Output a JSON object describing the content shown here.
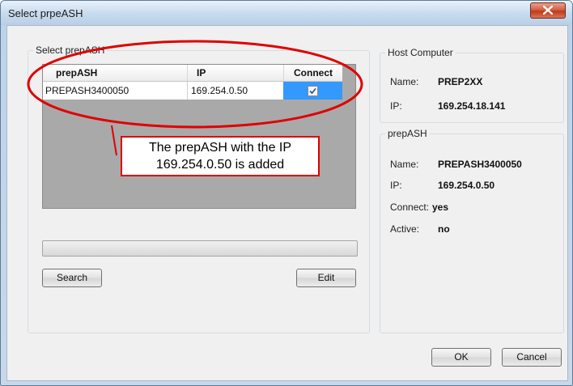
{
  "window": {
    "title": "Select prpeASH"
  },
  "select_group": {
    "legend": "Select prepASH"
  },
  "table": {
    "columns": [
      "prepASH",
      "IP",
      "Connect"
    ],
    "rows": [
      {
        "name": "PREPASH3400050",
        "ip": "169.254.0.50",
        "connect": true
      }
    ]
  },
  "buttons": {
    "search": "Search",
    "edit": "Edit",
    "ok": "OK",
    "cancel": "Cancel"
  },
  "host_group": {
    "legend": "Host Computer",
    "name_label": "Name:",
    "name_value": "PREP2XX",
    "ip_label": "IP:",
    "ip_value": "169.254.18.141"
  },
  "prepash_group": {
    "legend": "prepASH",
    "name_label": "Name:",
    "name_value": "PREPASH3400050",
    "ip_label": "IP:",
    "ip_value": "169.254.0.50",
    "connect_label": "Connect:",
    "connect_value": "yes",
    "active_label": "Active:",
    "active_value": "no"
  },
  "annotation": {
    "line1": "The prepASH with the IP",
    "line2": "169.254.0.50 is added",
    "color": "#e00000"
  }
}
